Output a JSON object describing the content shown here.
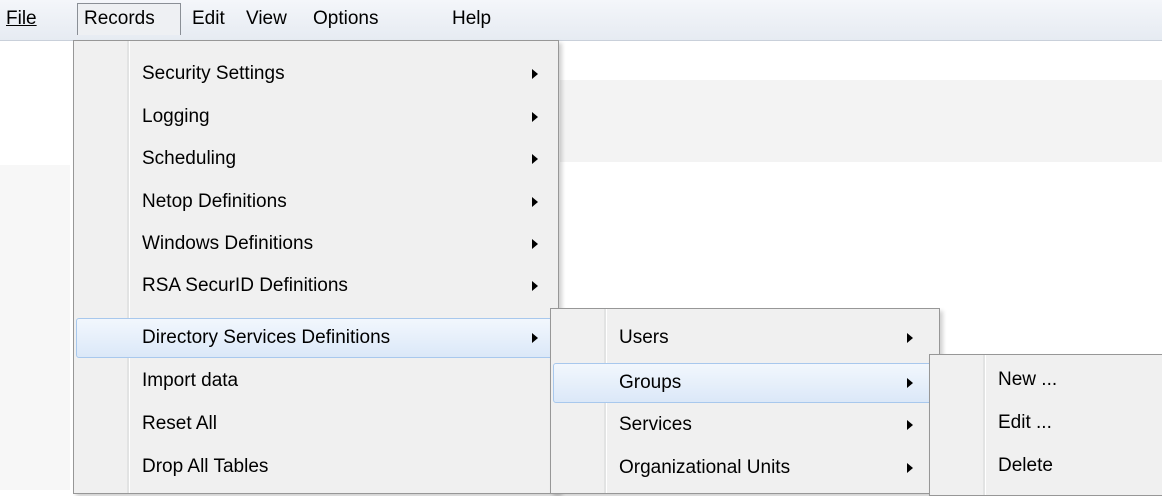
{
  "menubar": {
    "items": [
      {
        "label": "File"
      },
      {
        "label": "Records"
      },
      {
        "label": "Edit"
      },
      {
        "label": "View"
      },
      {
        "label": "Options"
      },
      {
        "label": "Help"
      }
    ]
  },
  "records_menu": {
    "items": [
      {
        "label": "Security Settings",
        "submenu": true
      },
      {
        "label": "Logging",
        "submenu": true
      },
      {
        "label": "Scheduling",
        "submenu": true
      },
      {
        "label": "Netop Definitions",
        "submenu": true
      },
      {
        "label": "Windows Definitions",
        "submenu": true
      },
      {
        "label": "RSA SecurID Definitions",
        "submenu": true
      },
      {
        "label": "Directory Services Definitions",
        "submenu": true,
        "highlighted": true
      },
      {
        "label": "Import data",
        "submenu": false
      },
      {
        "label": "Reset All",
        "submenu": false
      },
      {
        "label": "Drop All Tables",
        "submenu": false
      }
    ]
  },
  "directory_menu": {
    "items": [
      {
        "label": "Users",
        "submenu": true
      },
      {
        "label": "Groups",
        "submenu": true,
        "highlighted": true
      },
      {
        "label": "Services",
        "submenu": true
      },
      {
        "label": "Organizational Units",
        "submenu": true
      }
    ]
  },
  "groups_menu": {
    "items": [
      {
        "label": "New ..."
      },
      {
        "label": "Edit ..."
      },
      {
        "label": "Delete"
      }
    ]
  }
}
